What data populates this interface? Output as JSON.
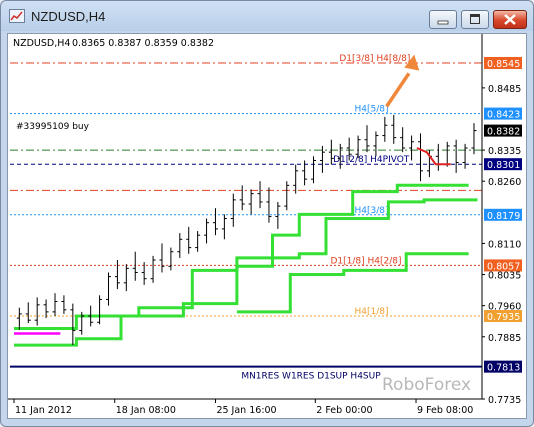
{
  "window": {
    "title": "NZDUSD,H4"
  },
  "chart_header": {
    "symbol": "NZDUSD,H4",
    "ohlc": "0.8365 0.8387 0.8359 0.8382"
  },
  "order_label": "#33995109 buy",
  "watermark": "RoboForex",
  "colors": {
    "candles": "#000000",
    "envelope": "#33e033",
    "sup_res_line": "#000066",
    "arrow": "#f0883c",
    "h1_8_line": "#f0a030",
    "resistance_line": "#e04020",
    "price_tag": "#000000",
    "blue_level": "#1e90ff"
  },
  "chart_data": {
    "type": "candlestick",
    "title": "NZDUSD,H4",
    "xlabel": "",
    "ylabel": "",
    "ylim": [
      0.7735,
      0.861
    ],
    "x_ticks": [
      "11 Jan 2012",
      "18 Jan 08:00",
      "25 Jan 16:00",
      "2 Feb 00:00",
      "9 Feb 08:00"
    ],
    "y_ticks": [
      0.8545,
      0.8423,
      0.8382,
      0.8335,
      0.8301,
      0.826,
      0.8179,
      0.811,
      0.8057,
      0.8035,
      0.796,
      0.7935,
      0.7885,
      0.7813,
      0.7735,
      0.8485
    ],
    "levels": [
      {
        "name": "D1[3/8] H4[8/8]",
        "value": 0.8545,
        "style": "dash-dot",
        "color": "#e04020",
        "tag_color": "#f06020"
      },
      {
        "name": "H4[5/8]",
        "value": 0.8423,
        "style": "dotted",
        "color": "#1e90ff",
        "tag_color": "#1e90ff"
      },
      {
        "name": "#33995109 buy",
        "value": 0.8335,
        "style": "dash-dot",
        "color": "#2a7a2a",
        "tag_color": null
      },
      {
        "name": "D1[2/8] H4PIVOT",
        "value": 0.8301,
        "style": "dashed",
        "color": "#000080",
        "tag_color": "#000080"
      },
      {
        "name": "",
        "value": 0.8238,
        "style": "dash-dot",
        "color": "#e04020",
        "tag_color": null
      },
      {
        "name": "H4[3/8]",
        "value": 0.8179,
        "style": "dotted",
        "color": "#1e90ff",
        "tag_color": "#1e90ff"
      },
      {
        "name": "D1[1/8] H4[2/8]",
        "value": 0.8057,
        "style": "dotted",
        "color": "#e04020",
        "tag_color": "#f06020"
      },
      {
        "name": "H4[1/8]",
        "value": 0.7935,
        "style": "dotted",
        "color": "#f0a030",
        "tag_color": "#f0a030"
      },
      {
        "name": "MN1RES W1RES D1SUP H4SUP",
        "value": 0.7813,
        "style": "solid",
        "color": "#000066",
        "tag_color": "#000066"
      }
    ],
    "last_price": 0.8382,
    "price_tags": [
      "0.8545",
      "0.8423",
      "0.8382",
      "0.8301",
      "0.8179",
      "0.8057",
      "0.7935",
      "0.7813"
    ],
    "candles": [
      [
        0.793,
        0.7955,
        0.7902,
        0.794
      ],
      [
        0.794,
        0.7968,
        0.7918,
        0.7925
      ],
      [
        0.7925,
        0.798,
        0.7912,
        0.7962
      ],
      [
        0.7962,
        0.7975,
        0.793,
        0.7945
      ],
      [
        0.7945,
        0.799,
        0.7935,
        0.797
      ],
      [
        0.797,
        0.7985,
        0.794,
        0.795
      ],
      [
        0.795,
        0.7965,
        0.7865,
        0.79
      ],
      [
        0.79,
        0.7945,
        0.789,
        0.7935
      ],
      [
        0.7935,
        0.796,
        0.791,
        0.792
      ],
      [
        0.792,
        0.7985,
        0.7915,
        0.7975
      ],
      [
        0.7975,
        0.804,
        0.796,
        0.803
      ],
      [
        0.803,
        0.807,
        0.8,
        0.8015
      ],
      [
        0.8015,
        0.806,
        0.7995,
        0.805
      ],
      [
        0.805,
        0.809,
        0.802,
        0.804
      ],
      [
        0.804,
        0.8065,
        0.801,
        0.8025
      ],
      [
        0.8025,
        0.808,
        0.8015,
        0.807
      ],
      [
        0.807,
        0.811,
        0.804,
        0.8055
      ],
      [
        0.8055,
        0.81,
        0.8045,
        0.809
      ],
      [
        0.809,
        0.8135,
        0.8075,
        0.812
      ],
      [
        0.812,
        0.815,
        0.8085,
        0.81
      ],
      [
        0.81,
        0.814,
        0.809,
        0.813
      ],
      [
        0.813,
        0.817,
        0.811,
        0.816
      ],
      [
        0.816,
        0.8195,
        0.813,
        0.8145
      ],
      [
        0.8145,
        0.818,
        0.812,
        0.817
      ],
      [
        0.817,
        0.823,
        0.815,
        0.8215
      ],
      [
        0.8215,
        0.825,
        0.819,
        0.8205
      ],
      [
        0.8205,
        0.824,
        0.818,
        0.823
      ],
      [
        0.823,
        0.826,
        0.8195,
        0.821
      ],
      [
        0.821,
        0.8245,
        0.816,
        0.8175
      ],
      [
        0.8175,
        0.821,
        0.8145,
        0.82
      ],
      [
        0.82,
        0.826,
        0.819,
        0.825
      ],
      [
        0.825,
        0.83,
        0.823,
        0.8285
      ],
      [
        0.8285,
        0.831,
        0.825,
        0.8265
      ],
      [
        0.8265,
        0.832,
        0.8255,
        0.831
      ],
      [
        0.831,
        0.8345,
        0.828,
        0.833
      ],
      [
        0.833,
        0.836,
        0.83,
        0.8315
      ],
      [
        0.8315,
        0.835,
        0.829,
        0.834
      ],
      [
        0.834,
        0.8365,
        0.831,
        0.8325
      ],
      [
        0.8325,
        0.837,
        0.8315,
        0.836
      ],
      [
        0.836,
        0.8395,
        0.833,
        0.8345
      ],
      [
        0.8345,
        0.838,
        0.832,
        0.837
      ],
      [
        0.837,
        0.8415,
        0.8355,
        0.8395
      ],
      [
        0.8395,
        0.842,
        0.835,
        0.8365
      ],
      [
        0.8365,
        0.839,
        0.833,
        0.834
      ],
      [
        0.834,
        0.837,
        0.831,
        0.8355
      ],
      [
        0.8355,
        0.8375,
        0.826,
        0.8285
      ],
      [
        0.8285,
        0.8335,
        0.827,
        0.832
      ],
      [
        0.832,
        0.835,
        0.8285,
        0.83
      ],
      [
        0.83,
        0.8355,
        0.8295,
        0.8345
      ],
      [
        0.8345,
        0.836,
        0.828,
        0.8305
      ],
      [
        0.8305,
        0.835,
        0.829,
        0.834
      ],
      [
        0.834,
        0.84,
        0.8325,
        0.8382
      ]
    ],
    "series": [
      {
        "name": "",
        "color": "#33e033",
        "values": [
          [
            0,
            0.7905
          ],
          [
            7,
            0.7905
          ],
          [
            7,
            0.7935
          ],
          [
            14,
            0.7935
          ],
          [
            14,
            0.7955
          ],
          [
            20,
            0.7955
          ],
          [
            20,
            0.8045
          ],
          [
            25,
            0.8045
          ],
          [
            25,
            0.8055
          ],
          [
            29,
            0.8055
          ],
          [
            29,
            0.813
          ],
          [
            32,
            0.813
          ],
          [
            32,
            0.818
          ],
          [
            38,
            0.818
          ],
          [
            38,
            0.8235
          ],
          [
            43,
            0.8235
          ],
          [
            43,
            0.825
          ],
          [
            51,
            0.825
          ]
        ]
      },
      {
        "name": "",
        "color": "#33e033",
        "values": [
          [
            0,
            0.7865
          ],
          [
            7,
            0.7865
          ],
          [
            7,
            0.788
          ],
          [
            12,
            0.788
          ],
          [
            12,
            0.7935
          ],
          [
            19,
            0.7935
          ],
          [
            19,
            0.7965
          ],
          [
            25,
            0.7965
          ],
          [
            25,
            0.8075
          ],
          [
            32,
            0.8075
          ],
          [
            32,
            0.8085
          ],
          [
            35,
            0.8085
          ],
          [
            35,
            0.817
          ],
          [
            42,
            0.817
          ],
          [
            42,
            0.821
          ],
          [
            46,
            0.821
          ],
          [
            46,
            0.8215
          ],
          [
            52,
            0.8215
          ]
        ]
      },
      {
        "name": "",
        "color": "#33e033",
        "values": [
          [
            25,
            0.7945
          ],
          [
            31,
            0.7945
          ],
          [
            31,
            0.8035
          ],
          [
            37,
            0.8035
          ],
          [
            37,
            0.8045
          ],
          [
            44,
            0.8045
          ],
          [
            44,
            0.8085
          ],
          [
            51,
            0.8085
          ]
        ]
      }
    ]
  }
}
